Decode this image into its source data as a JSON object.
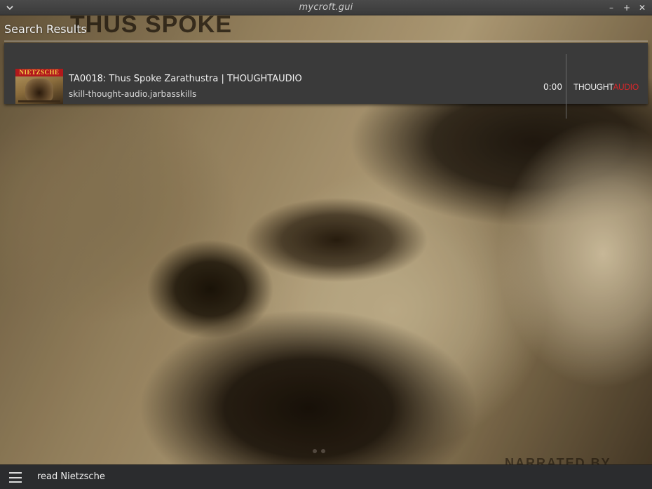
{
  "window": {
    "title": "mycroft.gui",
    "controls": {
      "menu_icon": "chevron-down-icon",
      "minimize": "–",
      "maximize": "+",
      "close": "✕"
    }
  },
  "background": {
    "caption_top": "THUS SPOKE",
    "caption_bottom": "NARRATED BY"
  },
  "page": {
    "heading": "Search Results"
  },
  "results": [
    {
      "title": "TA0018: Thus Spoke Zarathustra | THOUGHTAUDIO",
      "skill": "skill-thought-audio.jarbasskills",
      "duration": "0:00",
      "thumbnail_label": "NIETZSCHE",
      "logo_part_1": "THOUGHT",
      "logo_part_2": "AUDIO"
    }
  ],
  "bottom_bar": {
    "query": "read Nietzsche"
  },
  "colors": {
    "card_bg": "#3a3a3a",
    "bar_bg": "#2b2c2e",
    "logo_accent": "#d8262a"
  }
}
